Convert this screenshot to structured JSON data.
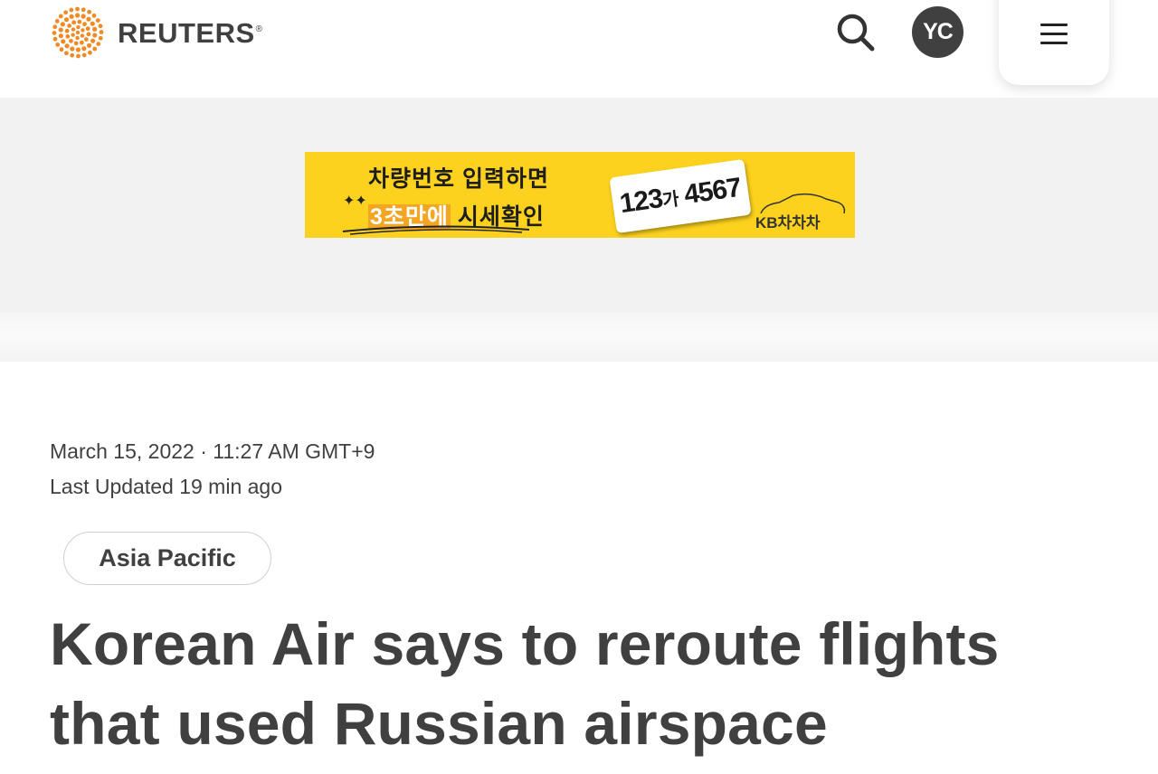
{
  "header": {
    "brand": "REUTERS",
    "brand_mark": "®",
    "avatar_initials": "YC",
    "search_icon": "search-icon",
    "menu_icon": "hamburger-menu-icon"
  },
  "ad": {
    "line1": "차량번호 입력하면",
    "line2_highlight": "3초만에",
    "line2_rest": " 시세확인",
    "plate_main": "123",
    "plate_char": "가",
    "plate_end": " 4567",
    "brand": "KB차차차",
    "background_color": "#fcd21e"
  },
  "article": {
    "published": "March 15, 2022 · 11:27 AM GMT+9",
    "updated": "Last Updated 19 min ago",
    "section_tag": "Asia Pacific",
    "headline": "Korean Air says to reroute flights that used Russian airspace"
  },
  "colors": {
    "logo_orange": "#f08a24",
    "text": "#404040"
  }
}
